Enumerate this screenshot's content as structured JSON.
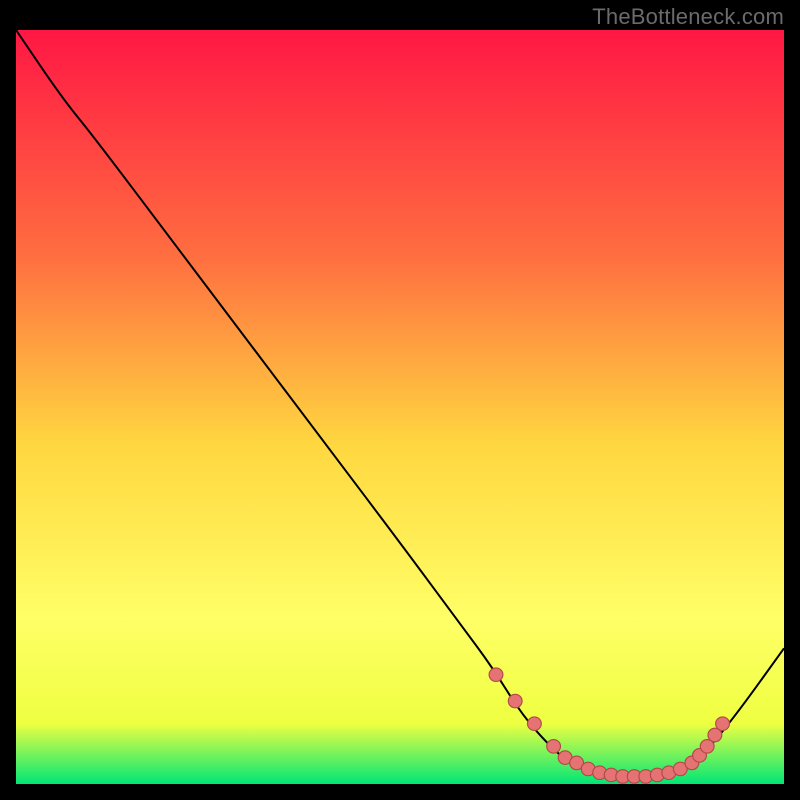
{
  "watermark": "TheBottleneck.com",
  "colors": {
    "gradient_top": "#ff1744",
    "gradient_mid_upper": "#ff6e40",
    "gradient_mid": "#ffd740",
    "gradient_mid_lower": "#ffff66",
    "gradient_low": "#eeff41",
    "gradient_bottom": "#00e676",
    "curve": "#000000",
    "marker_fill": "#e57373",
    "marker_stroke": "#b34747",
    "frame_bg": "#000000"
  },
  "chart_data": {
    "type": "line",
    "title": "",
    "xlabel": "",
    "ylabel": "",
    "xlim": [
      0,
      100
    ],
    "ylim": [
      0,
      100
    ],
    "series": [
      {
        "name": "bottleneck-curve",
        "x": [
          0,
          6,
          10,
          20,
          30,
          40,
          50,
          58,
          62,
          66,
          70,
          72,
          76,
          80,
          84,
          88,
          90,
          94,
          100
        ],
        "y": [
          100,
          91,
          86,
          72.5,
          59,
          45.5,
          32,
          21,
          15.5,
          9,
          4.5,
          3,
          1.5,
          1,
          1,
          2.5,
          4.5,
          9.5,
          18
        ]
      }
    ],
    "markers": {
      "name": "highlight-points",
      "x": [
        62.5,
        65,
        67.5,
        70,
        71.5,
        73,
        74.5,
        76,
        77.5,
        79,
        80.5,
        82,
        83.5,
        85,
        86.5,
        88,
        89,
        90,
        91,
        92
      ],
      "y": [
        14.5,
        11,
        8,
        5,
        3.5,
        2.8,
        2,
        1.5,
        1.2,
        1,
        1,
        1,
        1.2,
        1.5,
        2,
        2.8,
        3.8,
        5,
        6.5,
        8
      ]
    }
  }
}
